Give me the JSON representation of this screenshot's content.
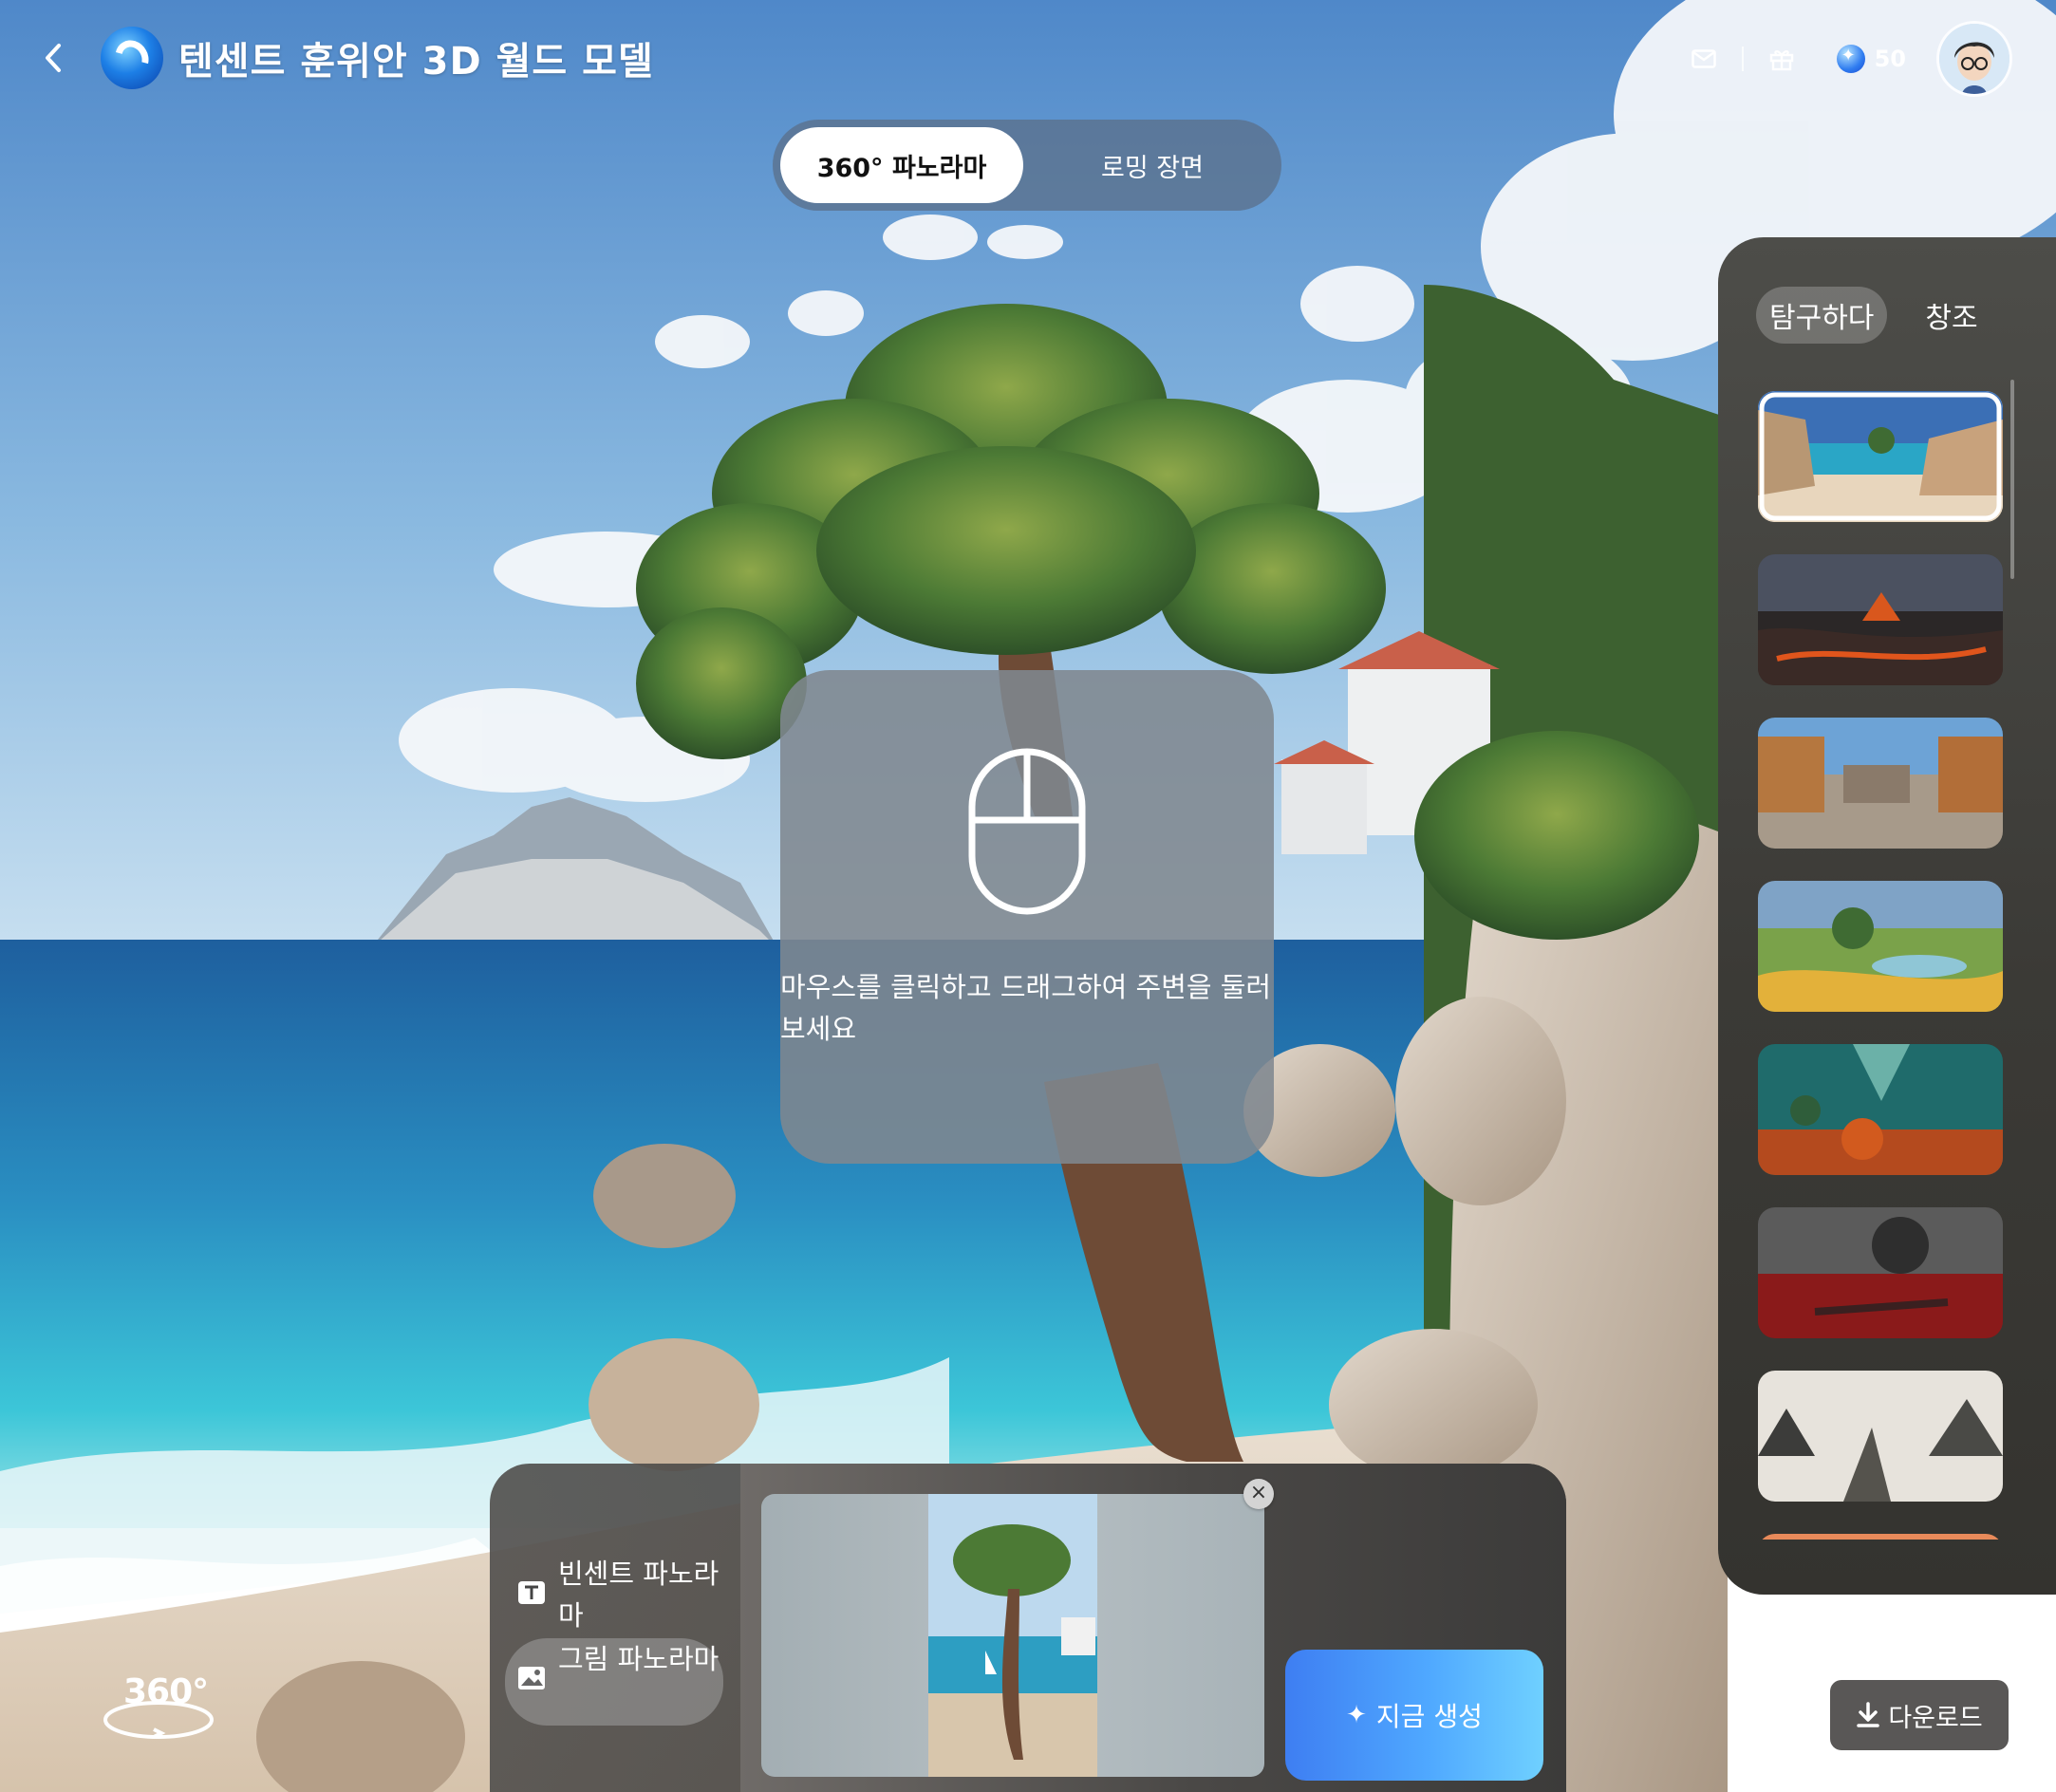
{
  "header": {
    "title": "텐센트 훈위안 3D 월드 모델",
    "credits": "50",
    "icons": [
      "back-icon",
      "app-logo",
      "mail-icon",
      "gift-icon",
      "credit-gem-icon",
      "user-avatar"
    ]
  },
  "mode_toggle": {
    "tabs": [
      {
        "label": "360° 파노라마",
        "active": true
      },
      {
        "label": "로밍 장면",
        "active": false
      }
    ]
  },
  "hint": {
    "text": "마우스를 클릭하고 드래그하여 주변을 둘러보세요",
    "icon": "mouse-icon"
  },
  "side_panel": {
    "tabs": [
      {
        "label": "탐구하다",
        "active": true
      },
      {
        "label": "창조",
        "active": false
      }
    ],
    "thumbnails": [
      {
        "scene": "beach cliffs",
        "selected": true
      },
      {
        "scene": "volcano lava",
        "selected": false
      },
      {
        "scene": "village street",
        "selected": false
      },
      {
        "scene": "meadow lake",
        "selected": false
      },
      {
        "scene": "underwater coral",
        "selected": false
      },
      {
        "scene": "burning ruins",
        "selected": false
      },
      {
        "scene": "ink mountains",
        "selected": false
      },
      {
        "scene": "sunset",
        "selected": false
      }
    ]
  },
  "input_bar": {
    "modes": [
      {
        "label": "빈센트 파노라마",
        "icon": "text-icon",
        "active": false
      },
      {
        "label": "그림 파노라마",
        "icon": "image-icon",
        "active": true
      }
    ],
    "generate_label": "지금 생성",
    "remove_icon": "close-icon"
  },
  "download_label": "다운로드",
  "badge_label": "360°",
  "colors": {
    "accent_gradient_start": "#3e7ef2",
    "accent_gradient_end": "#6fd0ff",
    "panel": "#3b3a36"
  }
}
